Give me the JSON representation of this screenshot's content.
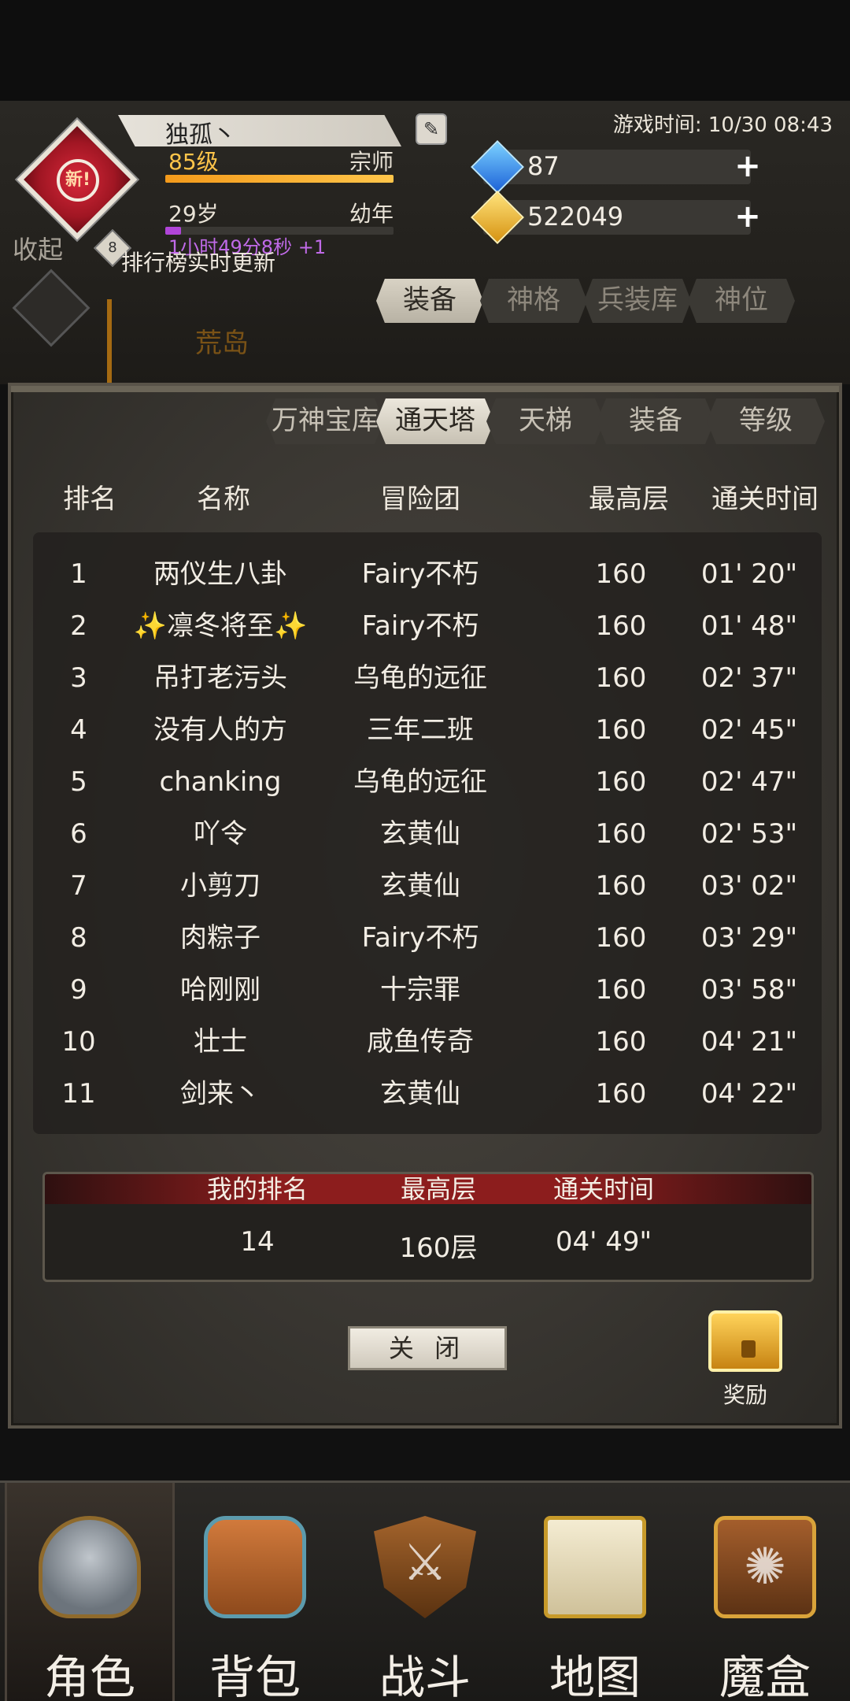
{
  "player": {
    "name": "独孤丶",
    "level": "85级",
    "title": "宗师",
    "age": "29岁",
    "age_stage": "幼年",
    "timer": "1小时49分8秒 +1",
    "avatar_badge": "8",
    "avatar_new": "新!",
    "level_progress": 1.0,
    "age_progress": 0.07
  },
  "game_time": "游戏时间: 10/30 08:43",
  "currencies": {
    "gems": "87",
    "gold": "522049"
  },
  "collapse_label": "收起",
  "subtabs": [
    "装备",
    "神格",
    "兵装库",
    "神位"
  ],
  "background_label": "荒岛",
  "live_update": "排行榜实时更新",
  "ranking": {
    "tabs": [
      "万神宝库",
      "通天塔",
      "天梯",
      "装备",
      "等级"
    ],
    "active_tab": "通天塔",
    "columns": [
      "排名",
      "名称",
      "冒险团",
      "最高层",
      "通关时间"
    ],
    "rows": [
      {
        "rank": "1",
        "name": "两仪生八卦",
        "guild": "Fairy不朽",
        "floor": "160",
        "time": "01' 20\""
      },
      {
        "rank": "2",
        "name": "✨凛冬将至✨",
        "guild": "Fairy不朽",
        "floor": "160",
        "time": "01' 48\""
      },
      {
        "rank": "3",
        "name": "吊打老污头",
        "guild": "乌龟的远征",
        "floor": "160",
        "time": "02' 37\""
      },
      {
        "rank": "4",
        "name": "没有人的方",
        "guild": "三年二班",
        "floor": "160",
        "time": "02' 45\""
      },
      {
        "rank": "5",
        "name": "chanking",
        "guild": "乌龟的远征",
        "floor": "160",
        "time": "02' 47\""
      },
      {
        "rank": "6",
        "name": "吖令",
        "guild": "玄黄仙",
        "floor": "160",
        "time": "02' 53\""
      },
      {
        "rank": "7",
        "name": "小剪刀",
        "guild": "玄黄仙",
        "floor": "160",
        "time": "03' 02\""
      },
      {
        "rank": "8",
        "name": "肉粽子",
        "guild": "Fairy不朽",
        "floor": "160",
        "time": "03' 29\""
      },
      {
        "rank": "9",
        "name": "哈刚刚",
        "guild": "十宗罪",
        "floor": "160",
        "time": "03' 58\""
      },
      {
        "rank": "10",
        "name": "壮士",
        "guild": "咸鱼传奇",
        "floor": "160",
        "time": "04' 21\""
      },
      {
        "rank": "11",
        "name": "剑来丶",
        "guild": "玄黄仙",
        "floor": "160",
        "time": "04' 22\""
      }
    ],
    "mine": {
      "rank_label": "我的排名",
      "floor_label": "最高层",
      "time_label": "通关时间",
      "rank": "14",
      "floor": "160层",
      "time": "04' 49\""
    },
    "close_label": "关 闭",
    "reward_label": "奖励"
  },
  "nav": [
    {
      "label": "角色",
      "icon": "helmet-icon"
    },
    {
      "label": "背包",
      "icon": "backpack-icon"
    },
    {
      "label": "战斗",
      "icon": "shield-sword-icon"
    },
    {
      "label": "地图",
      "icon": "scroll-map-icon"
    },
    {
      "label": "魔盒",
      "icon": "magic-box-icon"
    }
  ],
  "colors": {
    "level_text": "#ffc54a",
    "timer_text": "#c06ae8",
    "my_rank_header": "#8c1d1d"
  }
}
